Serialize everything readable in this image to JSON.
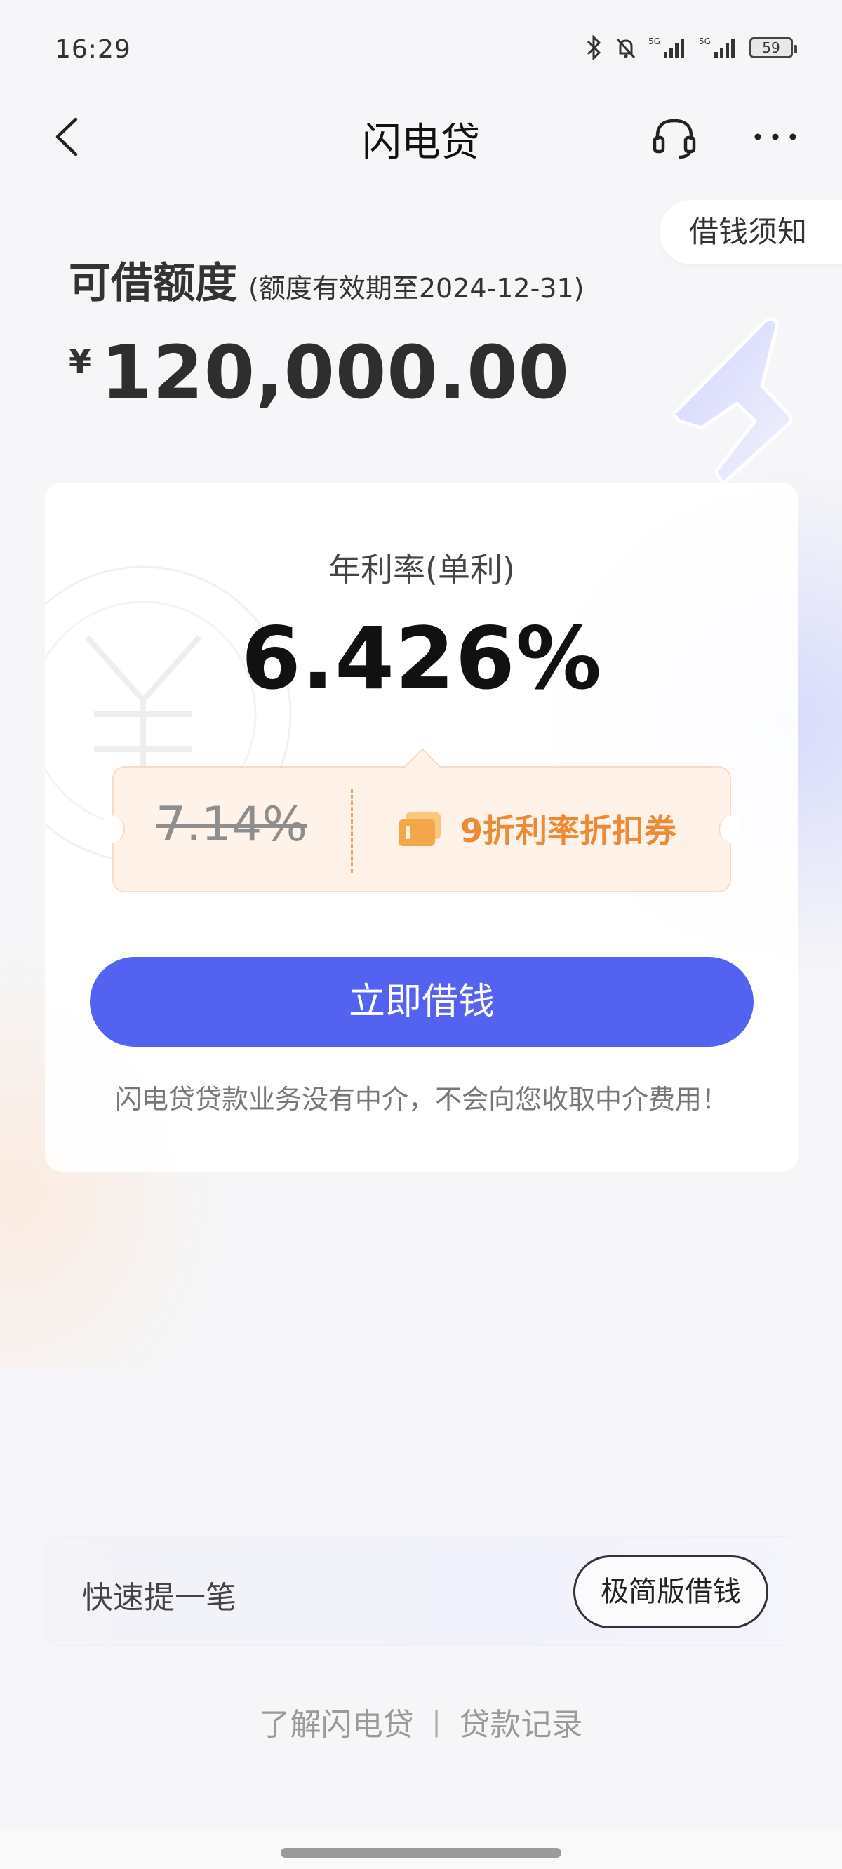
{
  "status_bar": {
    "time": "16:29",
    "battery": "59",
    "icons": [
      "bluetooth-icon",
      "silent-bell-icon",
      "signal-5g-icon",
      "signal-5g-icon",
      "battery-icon"
    ]
  },
  "nav": {
    "title": "闪电贷",
    "back_icon": "chevron-left-icon",
    "service_icon": "headset-icon",
    "more_icon": "more-dots-icon"
  },
  "notice_button": "借钱须知",
  "quota": {
    "label": "可借额度",
    "validity": "(额度有效期至2024-12-31)",
    "currency": "¥",
    "amount": "120,000.00"
  },
  "rate_card": {
    "label": "年利率(单利)",
    "value": "6.426%",
    "coupon": {
      "old_rate": "7.14%",
      "text": "9折利率折扣券"
    },
    "borrow_button": "立即借钱",
    "disclaimer": "闪电贷贷款业务没有中介，不会向您收取中介费用！"
  },
  "quick": {
    "label": "快速提一笔",
    "button": "极简版借钱"
  },
  "footer": {
    "link1": "了解闪电贷",
    "separator": "|",
    "link2": "贷款记录"
  },
  "colors": {
    "primary": "#5362f1",
    "coupon_text": "#ec8a35",
    "coupon_bg": "#fff3e9"
  }
}
